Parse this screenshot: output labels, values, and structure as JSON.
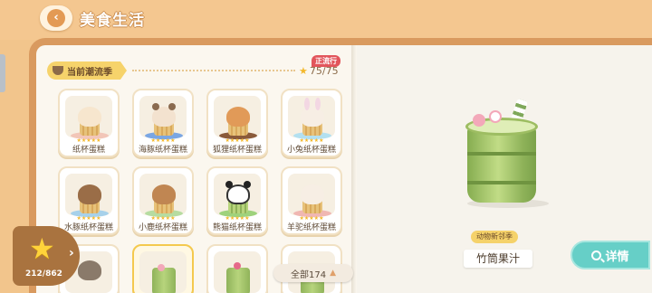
{
  "header": {
    "title": "美食生活",
    "back_icon": "back-arrow-icon"
  },
  "season": {
    "label": "当前潮流季",
    "progress": "75/75",
    "badge": "正流行"
  },
  "items": [
    {
      "name": "纸杯蛋糕",
      "stars": "★★★★★",
      "color": "#f2c6b8"
    },
    {
      "name": "海豚纸杯蛋糕",
      "stars": "★★★★★",
      "color": "#7aa6e3"
    },
    {
      "name": "狐狸纸杯蛋糕",
      "stars": "★★★★★",
      "color": "#e19a58"
    },
    {
      "name": "小兔纸杯蛋糕",
      "stars": "★★★★★",
      "color": "#f3d7e3"
    },
    {
      "name": "水豚纸杯蛋糕",
      "stars": "★★★★★",
      "color": "#a7d1ea"
    },
    {
      "name": "小鹿纸杯蛋糕",
      "stars": "★★★★★",
      "color": "#b6dca1"
    },
    {
      "name": "熊猫纸杯蛋糕",
      "stars": "★★★★★",
      "color": "#9ed27c"
    },
    {
      "name": "羊驼纸杯蛋糕",
      "stars": "★★★★★",
      "color": "#f0b7b2"
    }
  ],
  "collection": {
    "count": "212/862"
  },
  "filter": {
    "label": "全部174"
  },
  "selected": {
    "season": "动物新邻季",
    "name": "竹筒果汁"
  },
  "detail_button": {
    "label": "详情"
  }
}
